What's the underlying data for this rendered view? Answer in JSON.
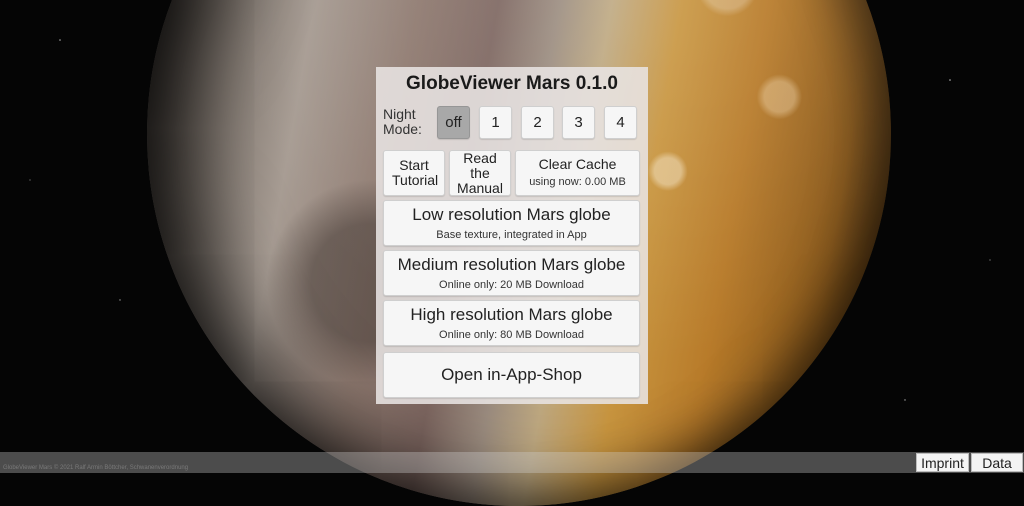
{
  "app": {
    "title": "GlobeViewer Mars 0.1.0"
  },
  "night_mode": {
    "label": "Night Mode:",
    "options": [
      "off",
      "1",
      "2",
      "3",
      "4"
    ],
    "selected": "off"
  },
  "actions": {
    "start_tutorial": "Start Tutorial",
    "read_manual": "Read the Manual",
    "clear_cache": "Clear Cache",
    "cache_usage": "using now: 0.00 MB"
  },
  "globes": [
    {
      "title": "Low resolution Mars globe",
      "subtitle": "Base texture, integrated in App"
    },
    {
      "title": "Medium resolution Mars globe",
      "subtitle": "Online only: 20 MB Download"
    },
    {
      "title": "High resolution Mars globe",
      "subtitle": "Online only: 80 MB Download"
    }
  ],
  "shop": {
    "label": "Open in-App-Shop"
  },
  "footer": {
    "copyright": "GlobeViewer Mars © 2021 Ralf Armin Böttcher, Schwanenverordnung",
    "imprint": "Imprint",
    "data": "Data"
  },
  "colors": {
    "panel_bg": "#e8e4e2",
    "button_bg": "#f6f6f6",
    "button_selected": "#a8a8a8"
  }
}
